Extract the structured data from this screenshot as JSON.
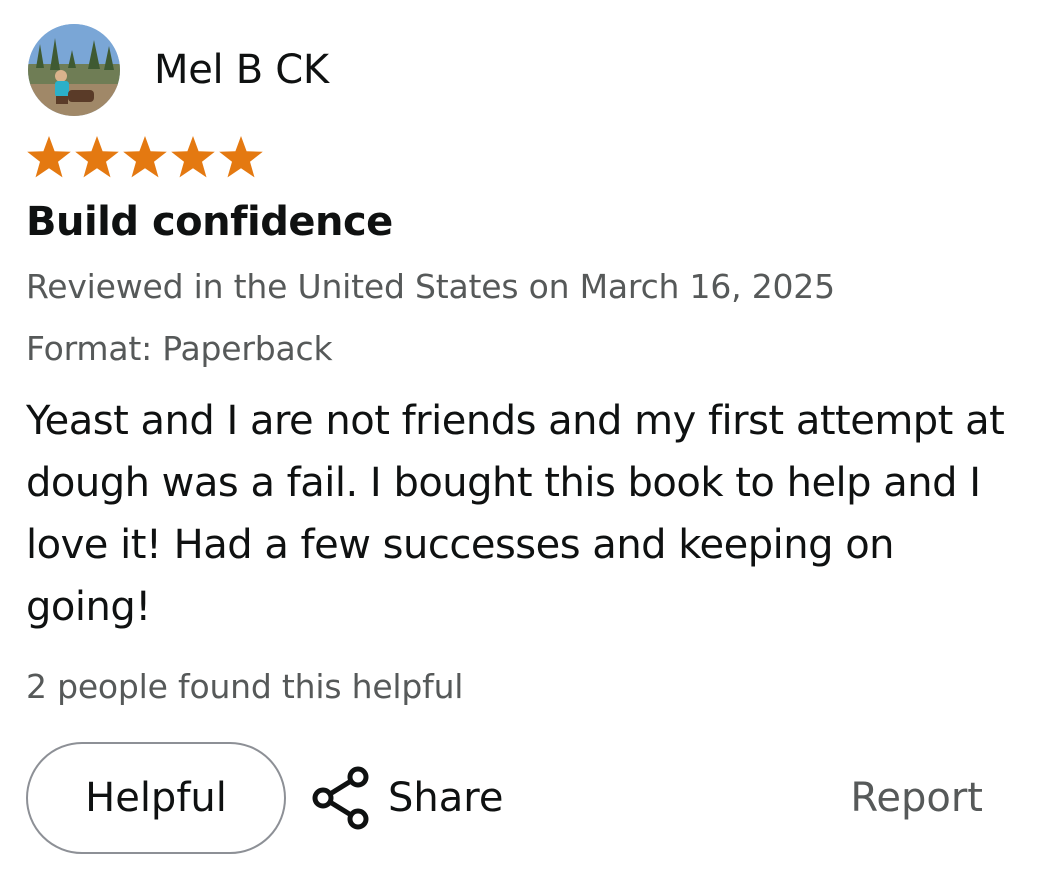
{
  "reviewer": {
    "name": "Mel B CK",
    "avatar_icon": "profile-photo"
  },
  "rating": {
    "stars": 5,
    "max": 5,
    "star_color": "#e47911"
  },
  "review": {
    "title": "Build confidence",
    "date_line": "Reviewed in the United States on March 16, 2025",
    "format_line": "Format: Paperback",
    "body": "Yeast and I are not friends and my first attempt at dough was a fail. I bought this book to help and I love it! Had a few successes and keeping on going!",
    "helpful_count_text": "2 people found this helpful"
  },
  "actions": {
    "helpful_label": "Helpful",
    "share_label": "Share",
    "share_icon": "share-icon",
    "report_label": "Report"
  },
  "colors": {
    "text": "#0f1111",
    "secondary_text": "#565959",
    "button_border": "#8d9096"
  }
}
